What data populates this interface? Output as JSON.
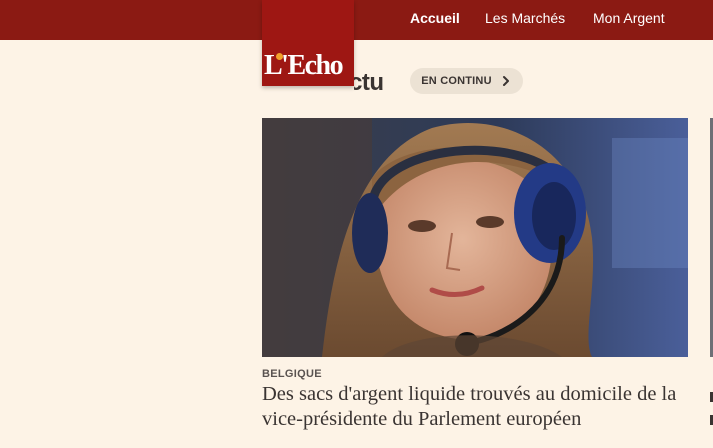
{
  "brand": {
    "logo_text": "L'Echo"
  },
  "nav": {
    "items": [
      {
        "label": "Accueil",
        "active": true
      },
      {
        "label": "Les Marchés",
        "active": false
      },
      {
        "label": "Mon Argent",
        "active": false
      }
    ]
  },
  "section": {
    "heading": "Dans l'actu",
    "live_button": "EN CONTINU"
  },
  "article": {
    "kicker": "BELGIQUE",
    "headline": "Des sacs d'argent liquide trouvés au domicile de la vice-présidente du Parlement européen"
  },
  "colors": {
    "topbar": "#8b1a13",
    "logo": "#9e1713",
    "background": "#fdf3e6",
    "pill": "#ece2d4",
    "text": "#3a3432"
  }
}
